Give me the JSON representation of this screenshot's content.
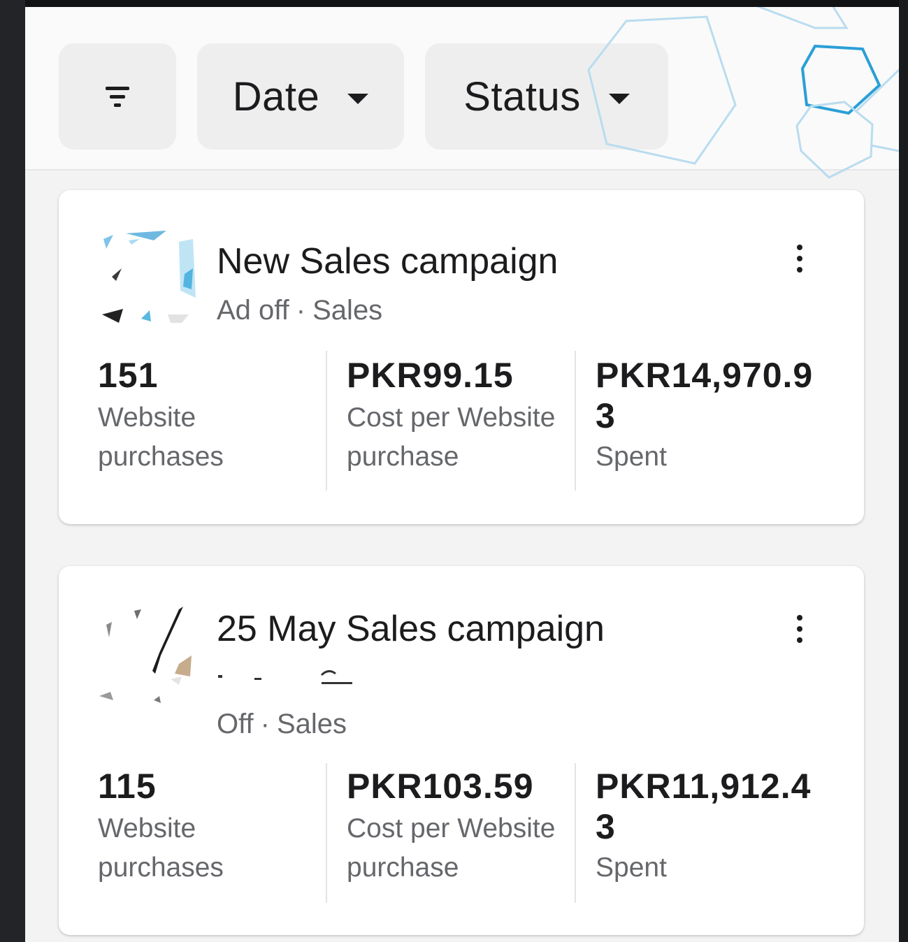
{
  "filters": {
    "filter_icon": "filter-lines-icon",
    "date_label": "Date",
    "status_label": "Status"
  },
  "campaigns": [
    {
      "name": "New Sales campaign",
      "status": "Ad off",
      "separator": "·",
      "objective": "Sales",
      "metrics": [
        {
          "value": "151",
          "label": "Website purchases"
        },
        {
          "value": "PKR99.15",
          "label": "Cost per Website purchase"
        },
        {
          "value": "PKR14,970.93",
          "label": "Spent"
        }
      ]
    },
    {
      "name": "25 May Sales campaign",
      "status": "Off",
      "separator": "·",
      "objective": "Sales",
      "metrics": [
        {
          "value": "115",
          "label": "Website purchases"
        },
        {
          "value": "PKR103.59",
          "label": "Cost per Website purchase"
        },
        {
          "value": "PKR11,912.43",
          "label": "Spent"
        }
      ]
    }
  ],
  "colors": {
    "text_primary": "#1c1c1e",
    "text_secondary": "#65676b",
    "chip_bg": "#eeeeef",
    "hex_accent": "#2a9fd6"
  }
}
